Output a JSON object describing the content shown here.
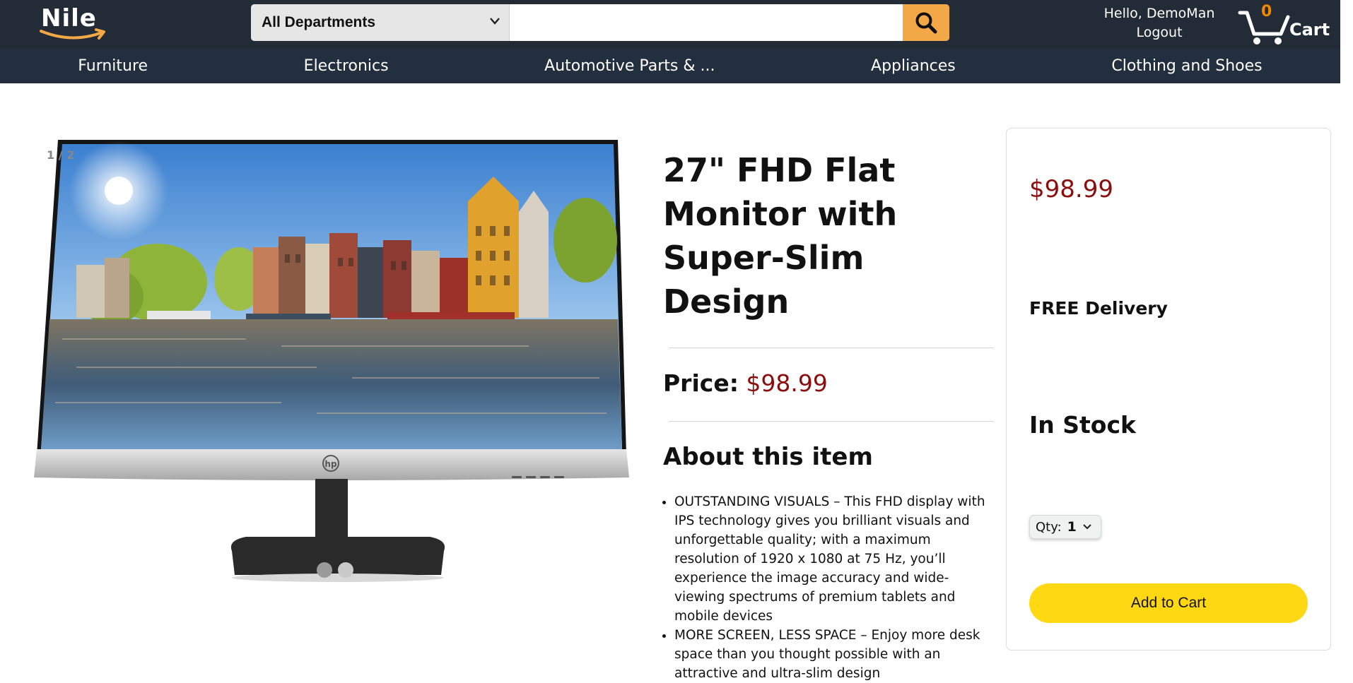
{
  "header": {
    "logo_text": "Nile",
    "department_select": "All Departments",
    "search_placeholder": "",
    "greeting": "Hello, DemoMan",
    "logout_label": "Logout",
    "cart_count": "0",
    "cart_label": "Cart"
  },
  "categories": [
    "Furniture",
    "Electronics",
    "Automotive Parts & ...",
    "Appliances",
    "Clothing and Shoes"
  ],
  "gallery": {
    "counter": "1 / 2",
    "current_image": 1,
    "total_images": 2
  },
  "product": {
    "title": "27\" FHD Flat Monitor with Super-Slim Design",
    "price_label": "Price:",
    "price": "$98.99",
    "about_heading": "About this item",
    "bullets": [
      "OUTSTANDING VISUALS – This FHD display with IPS technology gives you brilliant visuals and unforgettable quality; with a maximum resolution of 1920 x 1080 at 75 Hz, you’ll experience the image accuracy and wide-viewing spectrums of premium tablets and mobile devices",
      "MORE SCREEN, LESS SPACE – Enjoy more desk space than you thought possible with an attractive and ultra-slim design"
    ]
  },
  "buybox": {
    "price": "$98.99",
    "delivery": "FREE Delivery",
    "stock": "In Stock",
    "qty_label": "Qty:",
    "qty_value": "1",
    "add_to_cart_label": "Add to Cart"
  },
  "colors": {
    "header_bg": "#222b36",
    "nav_bg": "#232f3e",
    "search_button": "#f3a847",
    "price": "#8b0d0d",
    "add_to_cart": "#ffd814",
    "cart_count": "#f08804"
  },
  "icons": {
    "search": "search-icon",
    "cart": "cart-icon",
    "dropdown": "chevron-down-icon"
  }
}
